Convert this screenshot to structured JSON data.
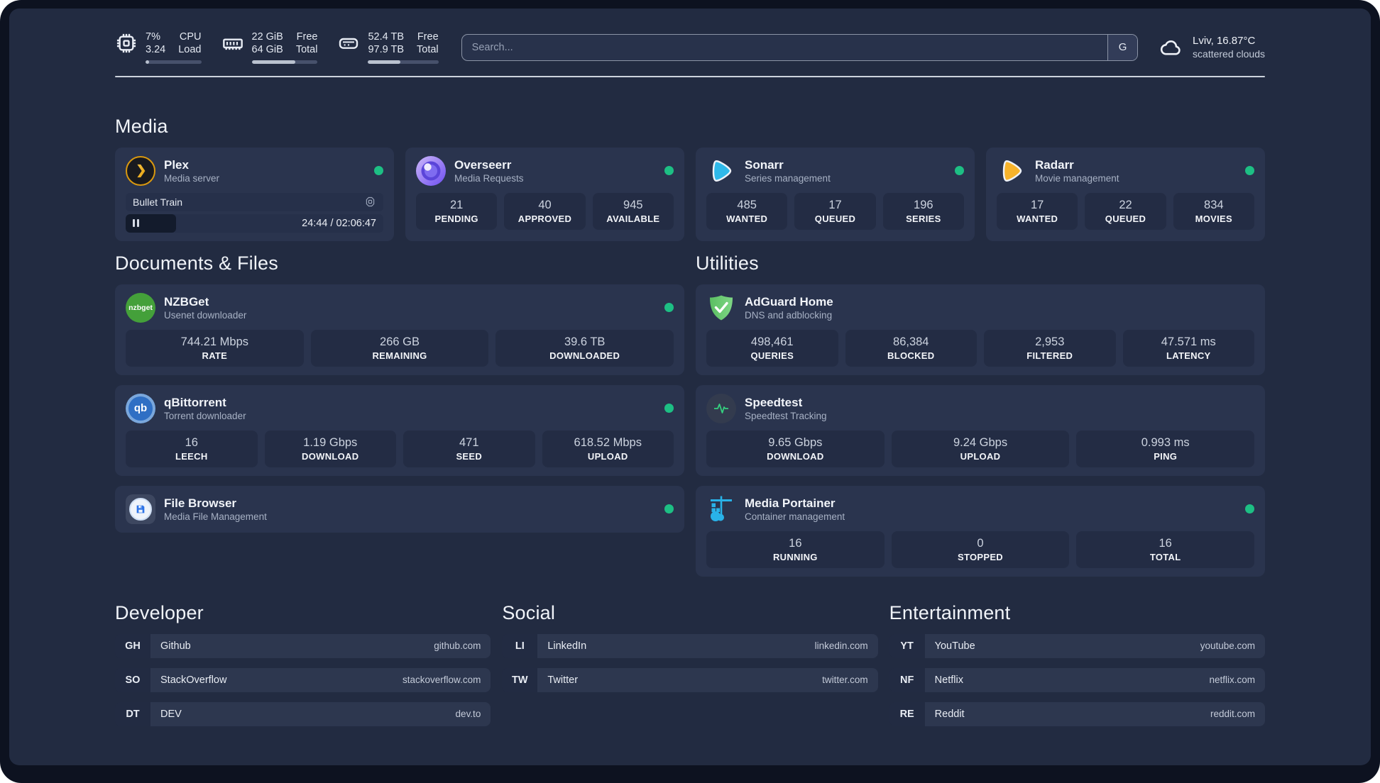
{
  "header": {
    "cpu": {
      "value1": "7%",
      "value2": "3.24",
      "label1": "CPU",
      "label2": "Load",
      "progress": 7
    },
    "ram": {
      "value1": "22 GiB",
      "value2": "64 GiB",
      "label1": "Free",
      "label2": "Total",
      "progress": 66
    },
    "disk": {
      "value1": "52.4 TB",
      "value2": "97.9 TB",
      "label1": "Free",
      "label2": "Total",
      "progress": 46
    },
    "search": {
      "placeholder": "Search...",
      "button_label": "G"
    },
    "weather": {
      "location": "Lviv, 16.87°C",
      "condition": "scattered clouds"
    }
  },
  "colors": {
    "status_green": "#1dbf84"
  },
  "media": {
    "title": "Media",
    "plex": {
      "title": "Plex",
      "subtitle": "Media server",
      "now_playing": "Bullet Train",
      "time": "24:44 / 02:06:47",
      "progress": 19.5
    },
    "overseerr": {
      "title": "Overseerr",
      "subtitle": "Media Requests",
      "stats": [
        {
          "value": "21",
          "label": "PENDING"
        },
        {
          "value": "40",
          "label": "APPROVED"
        },
        {
          "value": "945",
          "label": "AVAILABLE"
        }
      ]
    },
    "sonarr": {
      "title": "Sonarr",
      "subtitle": "Series management",
      "stats": [
        {
          "value": "485",
          "label": "WANTED"
        },
        {
          "value": "17",
          "label": "QUEUED"
        },
        {
          "value": "196",
          "label": "SERIES"
        }
      ]
    },
    "radarr": {
      "title": "Radarr",
      "subtitle": "Movie management",
      "stats": [
        {
          "value": "17",
          "label": "WANTED"
        },
        {
          "value": "22",
          "label": "QUEUED"
        },
        {
          "value": "834",
          "label": "MOVIES"
        }
      ]
    }
  },
  "documents": {
    "title": "Documents & Files",
    "nzbget": {
      "title": "NZBGet",
      "subtitle": "Usenet downloader",
      "icon_text": "nzbget",
      "stats": [
        {
          "value": "744.21 Mbps",
          "label": "RATE"
        },
        {
          "value": "266 GB",
          "label": "REMAINING"
        },
        {
          "value": "39.6 TB",
          "label": "DOWNLOADED"
        }
      ]
    },
    "qbittorrent": {
      "title": "qBittorrent",
      "subtitle": "Torrent downloader",
      "icon_text": "qb",
      "stats": [
        {
          "value": "16",
          "label": "LEECH"
        },
        {
          "value": "1.19 Gbps",
          "label": "DOWNLOAD"
        },
        {
          "value": "471",
          "label": "SEED"
        },
        {
          "value": "618.52 Mbps",
          "label": "UPLOAD"
        }
      ]
    },
    "filebrowser": {
      "title": "File Browser",
      "subtitle": "Media File Management"
    }
  },
  "utilities": {
    "title": "Utilities",
    "adguard": {
      "title": "AdGuard Home",
      "subtitle": "DNS and adblocking",
      "stats": [
        {
          "value": "498,461",
          "label": "QUERIES"
        },
        {
          "value": "86,384",
          "label": "BLOCKED"
        },
        {
          "value": "2,953",
          "label": "FILTERED"
        },
        {
          "value": "47.571 ms",
          "label": "LATENCY"
        }
      ]
    },
    "speedtest": {
      "title": "Speedtest",
      "subtitle": "Speedtest Tracking",
      "stats": [
        {
          "value": "9.65 Gbps",
          "label": "DOWNLOAD"
        },
        {
          "value": "9.24 Gbps",
          "label": "UPLOAD"
        },
        {
          "value": "0.993 ms",
          "label": "PING"
        }
      ]
    },
    "portainer": {
      "title": "Media Portainer",
      "subtitle": "Container management",
      "stats": [
        {
          "value": "16",
          "label": "RUNNING"
        },
        {
          "value": "0",
          "label": "STOPPED"
        },
        {
          "value": "16",
          "label": "TOTAL"
        }
      ]
    }
  },
  "links": {
    "developer": {
      "title": "Developer",
      "items": [
        {
          "abbr": "GH",
          "name": "Github",
          "url": "github.com"
        },
        {
          "abbr": "SO",
          "name": "StackOverflow",
          "url": "stackoverflow.com"
        },
        {
          "abbr": "DT",
          "name": "DEV",
          "url": "dev.to"
        }
      ]
    },
    "social": {
      "title": "Social",
      "items": [
        {
          "abbr": "LI",
          "name": "LinkedIn",
          "url": "linkedin.com"
        },
        {
          "abbr": "TW",
          "name": "Twitter",
          "url": "twitter.com"
        }
      ]
    },
    "entertainment": {
      "title": "Entertainment",
      "items": [
        {
          "abbr": "YT",
          "name": "YouTube",
          "url": "youtube.com"
        },
        {
          "abbr": "NF",
          "name": "Netflix",
          "url": "netflix.com"
        },
        {
          "abbr": "RE",
          "name": "Reddit",
          "url": "reddit.com"
        }
      ]
    }
  }
}
